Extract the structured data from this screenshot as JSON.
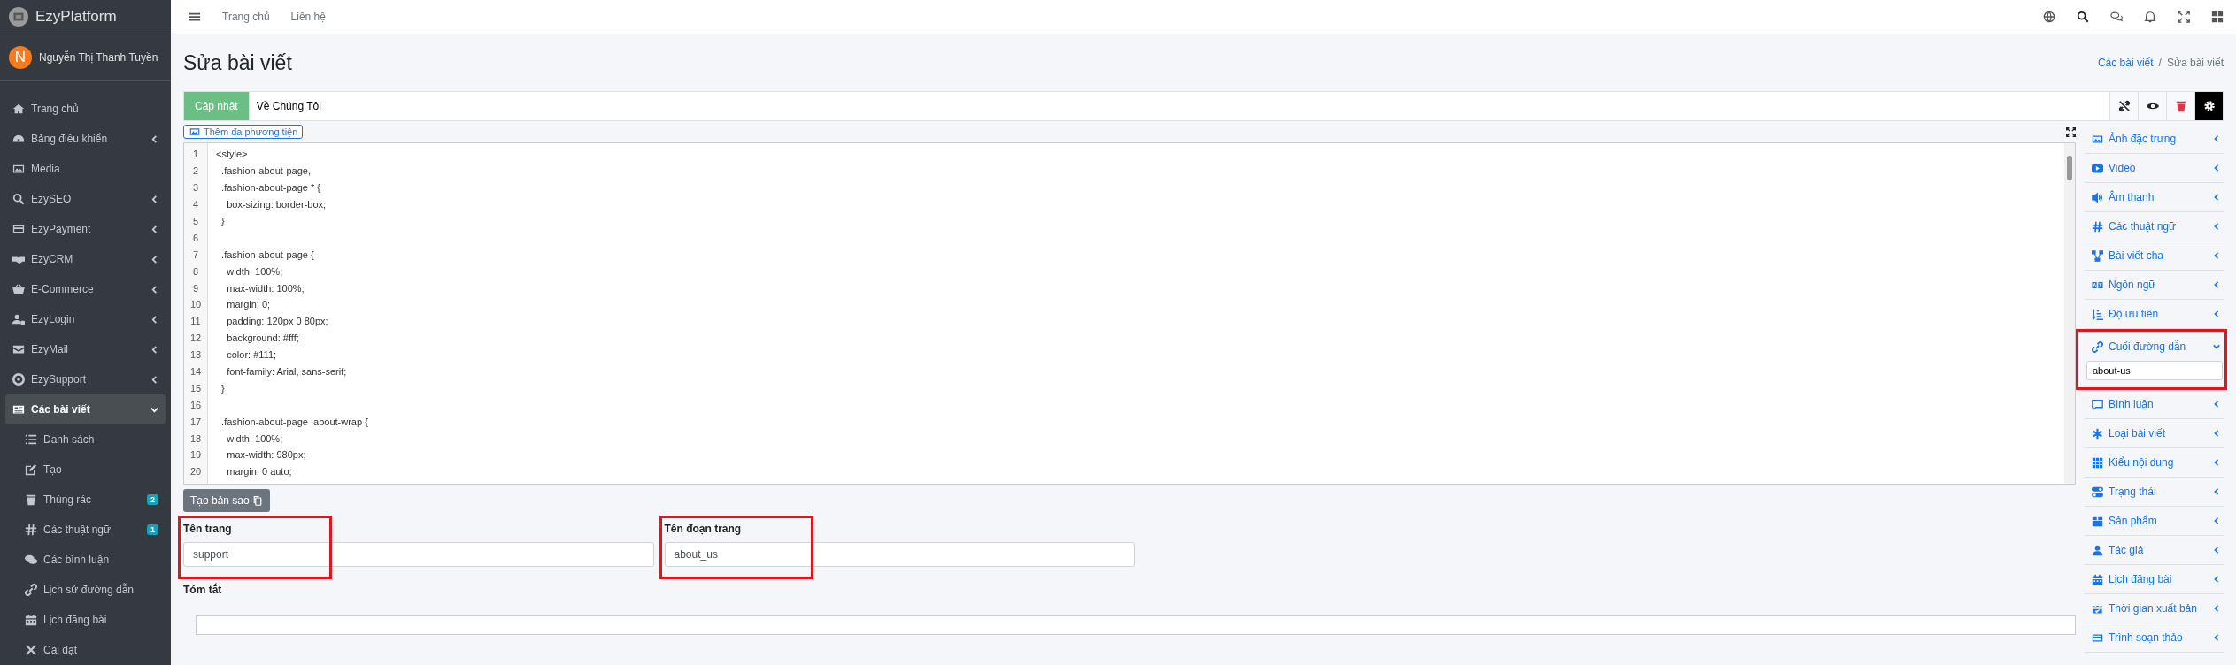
{
  "brand": "EzyPlatform",
  "user": {
    "initial": "N",
    "name": "Nguyễn Thị Thanh Tuyền"
  },
  "sidebar": {
    "items": [
      {
        "label": "Trang chủ",
        "kind": "link",
        "selected": false
      },
      {
        "label": "Bảng điều khiển",
        "kind": "submenu",
        "selected": false,
        "expanded": false
      },
      {
        "label": "Media",
        "kind": "link",
        "selected": false
      },
      {
        "label": "EzySEO",
        "kind": "submenu",
        "selected": false,
        "expanded": false
      },
      {
        "label": "EzyPayment",
        "kind": "submenu",
        "selected": false,
        "expanded": false
      },
      {
        "label": "EzyCRM",
        "kind": "submenu",
        "selected": false,
        "expanded": false
      },
      {
        "label": "E-Commerce",
        "kind": "submenu",
        "selected": false,
        "expanded": false
      },
      {
        "label": "EzyLogin",
        "kind": "submenu",
        "selected": false,
        "expanded": false
      },
      {
        "label": "EzyMail",
        "kind": "submenu",
        "selected": false,
        "expanded": false
      },
      {
        "label": "EzySupport",
        "kind": "submenu",
        "selected": false,
        "expanded": false
      },
      {
        "label": "Các bài viết",
        "kind": "submenu",
        "selected": true,
        "expanded": true,
        "children": [
          {
            "label": "Danh sách"
          },
          {
            "label": "Tạo"
          },
          {
            "label": "Thùng rác",
            "badge": "2"
          },
          {
            "label": "Các thuật ngữ",
            "badge": "1"
          },
          {
            "label": "Các bình luận"
          },
          {
            "label": "Lịch sử đường dẫn"
          },
          {
            "label": "Lịch đăng bài"
          },
          {
            "label": "Cài đặt"
          }
        ]
      }
    ]
  },
  "top_nav": [
    "Trang chủ",
    "Liên hệ"
  ],
  "page_title": "Sửa bài viết",
  "breadcrumb_separator": "/",
  "breadcrumb": [
    {
      "label": "Các bài viết",
      "kind": "link"
    },
    {
      "label": "Sửa bài viết",
      "kind": "current"
    }
  ],
  "update_button": "Cập nhật",
  "title_field": {
    "value": "Về Chúng Tôi"
  },
  "media_button": "Thêm đa phương tiện",
  "code_lines": [
    {
      "number": "1",
      "text": "<style>"
    },
    {
      "number": "2",
      "text": "  .fashion-about-page,"
    },
    {
      "number": "3",
      "text": "  .fashion-about-page * {"
    },
    {
      "number": "4",
      "text": "    box-sizing: border-box;"
    },
    {
      "number": "5",
      "text": "  }"
    },
    {
      "number": "6"
    },
    {
      "number": "7",
      "text": "  .fashion-about-page {"
    },
    {
      "number": "8",
      "text": "    width: 100%;"
    },
    {
      "number": "9",
      "text": "    max-width: 100%;"
    },
    {
      "number": "10",
      "text": "    margin: 0;"
    },
    {
      "number": "11",
      "text": "    padding: 120px 0 80px;"
    },
    {
      "number": "12",
      "text": "    background: #fff;"
    },
    {
      "number": "13",
      "text": "    color: #111;"
    },
    {
      "number": "14",
      "text": "    font-family: Arial, sans-serif;"
    },
    {
      "number": "15",
      "text": "  }"
    },
    {
      "number": "16"
    },
    {
      "number": "17",
      "text": "  .fashion-about-page .about-wrap {"
    },
    {
      "number": "18",
      "text": "    width: 100%;"
    },
    {
      "number": "19",
      "text": "    max-width: 980px;"
    },
    {
      "number": "20",
      "text": "    margin: 0 auto;"
    }
  ],
  "copy_button": "Tạo bản sao",
  "fields": [
    {
      "label": "Tên trang",
      "value": "support",
      "highlighted": true
    },
    {
      "label": "Tên đoạn trang",
      "value": "about_us",
      "highlighted": true
    }
  ],
  "summary_label": "Tóm tắt",
  "right_panel": [
    {
      "label": "Ảnh đặc trưng",
      "expanded": false,
      "highlighted": false
    },
    {
      "label": "Video",
      "expanded": false,
      "highlighted": false
    },
    {
      "label": "Âm thanh",
      "expanded": false,
      "highlighted": false
    },
    {
      "label": "Các thuật ngữ",
      "expanded": false,
      "highlighted": false
    },
    {
      "label": "Bài viết cha",
      "expanded": false,
      "highlighted": false
    },
    {
      "label": "Ngôn ngữ",
      "expanded": false,
      "highlighted": false
    },
    {
      "label": "Độ ưu tiên",
      "expanded": false,
      "highlighted": false
    },
    {
      "label": "Cuối đường dẫn",
      "expanded": true,
      "highlighted": true,
      "value": "about-us"
    },
    {
      "label": "Bình luận",
      "expanded": false,
      "highlighted": false
    },
    {
      "label": "Loại bài viết",
      "expanded": false,
      "highlighted": false
    },
    {
      "label": "Kiểu nội dung",
      "expanded": false,
      "highlighted": false
    },
    {
      "label": "Trạng thái",
      "expanded": false,
      "highlighted": false
    },
    {
      "label": "Sản phẩm",
      "expanded": false,
      "highlighted": false
    },
    {
      "label": "Tác giả",
      "expanded": false,
      "highlighted": false
    },
    {
      "label": "Lịch đăng bài",
      "expanded": false,
      "highlighted": false
    },
    {
      "label": "Thời gian xuất bản",
      "expanded": false,
      "highlighted": false
    },
    {
      "label": "Trình soạn thảo",
      "expanded": false,
      "highlighted": false
    }
  ]
}
